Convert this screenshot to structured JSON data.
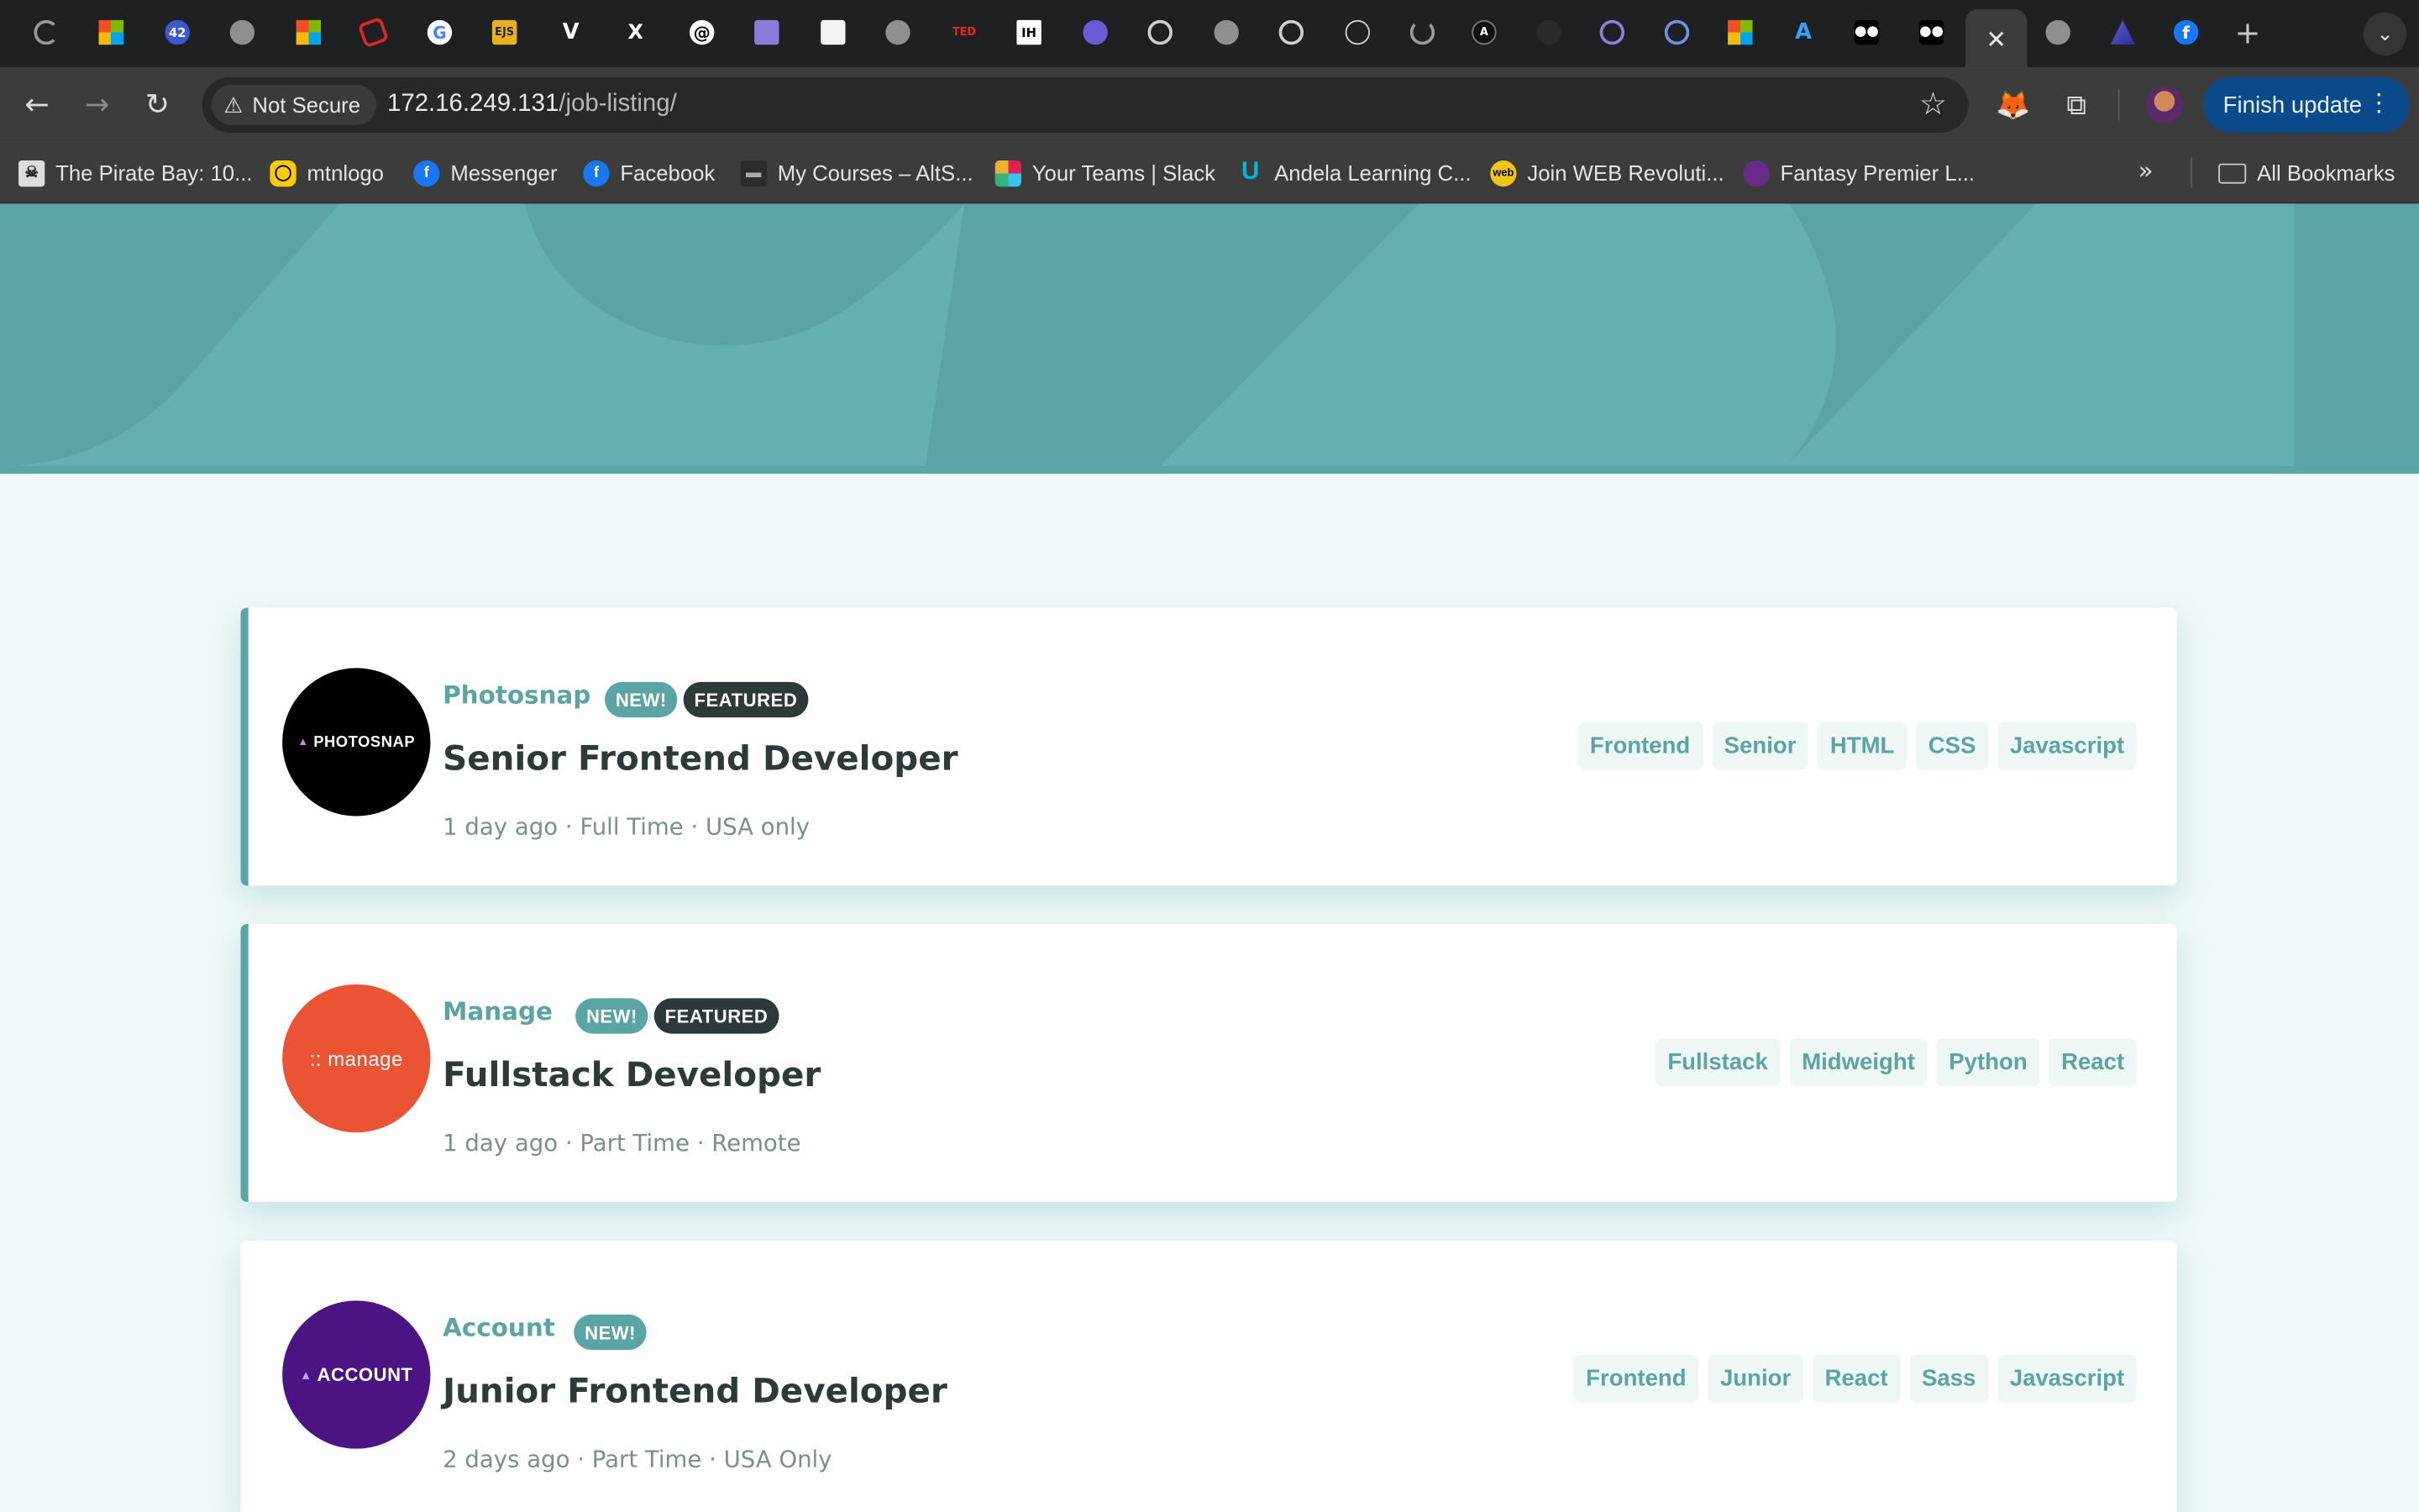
{
  "browser": {
    "tabs": [
      {
        "icon": "loading-circle-icon"
      },
      {
        "icon": "microsoft-icon"
      },
      {
        "icon": "42-badge-icon",
        "label": "42"
      },
      {
        "icon": "globe-icon"
      },
      {
        "icon": "microsoft-icon"
      },
      {
        "icon": "red-logo-icon"
      },
      {
        "icon": "google-icon"
      },
      {
        "icon": "ejs-icon",
        "label": "EJS"
      },
      {
        "icon": "v-logo-icon"
      },
      {
        "icon": "x-logo-icon"
      },
      {
        "icon": "threads-icon"
      },
      {
        "icon": "book-icon"
      },
      {
        "icon": "white-square-icon"
      },
      {
        "icon": "globe-icon"
      },
      {
        "icon": "ted-icon",
        "label": "TED"
      },
      {
        "icon": "ih-icon",
        "label": "IH"
      },
      {
        "icon": "purple-circle-icon"
      },
      {
        "icon": "openai-icon"
      },
      {
        "icon": "globe-icon"
      },
      {
        "icon": "openai-icon"
      },
      {
        "icon": "empty-circle-icon"
      },
      {
        "icon": "loading-circle-icon"
      },
      {
        "icon": "a-circle-icon"
      },
      {
        "icon": "dark-circle-icon"
      },
      {
        "icon": "list-circle-icon"
      },
      {
        "icon": "list-circle-icon"
      },
      {
        "icon": "microsoft-icon"
      },
      {
        "icon": "a-logo-icon"
      },
      {
        "icon": "medium-icon"
      },
      {
        "icon": "medium-icon"
      },
      {
        "icon": "close-icon",
        "active": true
      },
      {
        "icon": "globe-icon"
      },
      {
        "icon": "a-triangle-icon"
      },
      {
        "icon": "facebook-icon"
      }
    ],
    "security_label": "Not Secure",
    "url_host": "172.16.249.131",
    "url_path": "/job-listing/",
    "finish_update_label": "Finish update",
    "bookmarks": [
      {
        "label": "The Pirate Bay: 10...",
        "icon": "pirate-icon"
      },
      {
        "label": "mtnlogo",
        "icon": "mtn-icon"
      },
      {
        "label": "Messenger",
        "icon": "facebook-icon"
      },
      {
        "label": "Facebook",
        "icon": "facebook-icon"
      },
      {
        "label": "My Courses – AltS...",
        "icon": "school-icon"
      },
      {
        "label": "Your Teams | Slack",
        "icon": "slack-icon"
      },
      {
        "label": "Andela Learning C...",
        "icon": "udacity-icon"
      },
      {
        "label": "Join WEB Revoluti...",
        "icon": "web-icon"
      },
      {
        "label": "Fantasy Premier L...",
        "icon": "premier-league-icon"
      }
    ],
    "all_bookmarks_label": "All Bookmarks"
  },
  "jobs": [
    {
      "company": "Photosnap",
      "logo_text": "PHOTOSNAP",
      "logo_color": "#000000",
      "new_label": "NEW!",
      "featured_label": "FEATURED",
      "position": "Senior Frontend Developer",
      "posted": "1 day ago",
      "contract": "Full Time",
      "location": "USA only",
      "tags": [
        "Frontend",
        "Senior",
        "HTML",
        "CSS",
        "Javascript"
      ]
    },
    {
      "company": "Manage",
      "logo_text": ":: manage",
      "logo_color": "#ea5434",
      "new_label": "NEW!",
      "featured_label": "FEATURED",
      "position": "Fullstack Developer",
      "posted": "1 day ago",
      "contract": "Part Time",
      "location": "Remote",
      "tags": [
        "Fullstack",
        "Midweight",
        "Python",
        "React"
      ]
    },
    {
      "company": "Account",
      "logo_text": "ACCOUNT",
      "logo_color": "#4c1382",
      "new_label": "NEW!",
      "position": "Junior Frontend Developer",
      "posted": "2 days ago",
      "contract": "Part Time",
      "location": "USA Only",
      "tags": [
        "Frontend",
        "Junior",
        "React",
        "Sass",
        "Javascript"
      ]
    }
  ],
  "colors": {
    "primary": "#5ba4a4",
    "page_background": "#eef8f8",
    "tag_background": "#eef6f6",
    "heading": "#2c3a3a",
    "meta_text": "#7b8e8e"
  },
  "meta_separator": " · "
}
